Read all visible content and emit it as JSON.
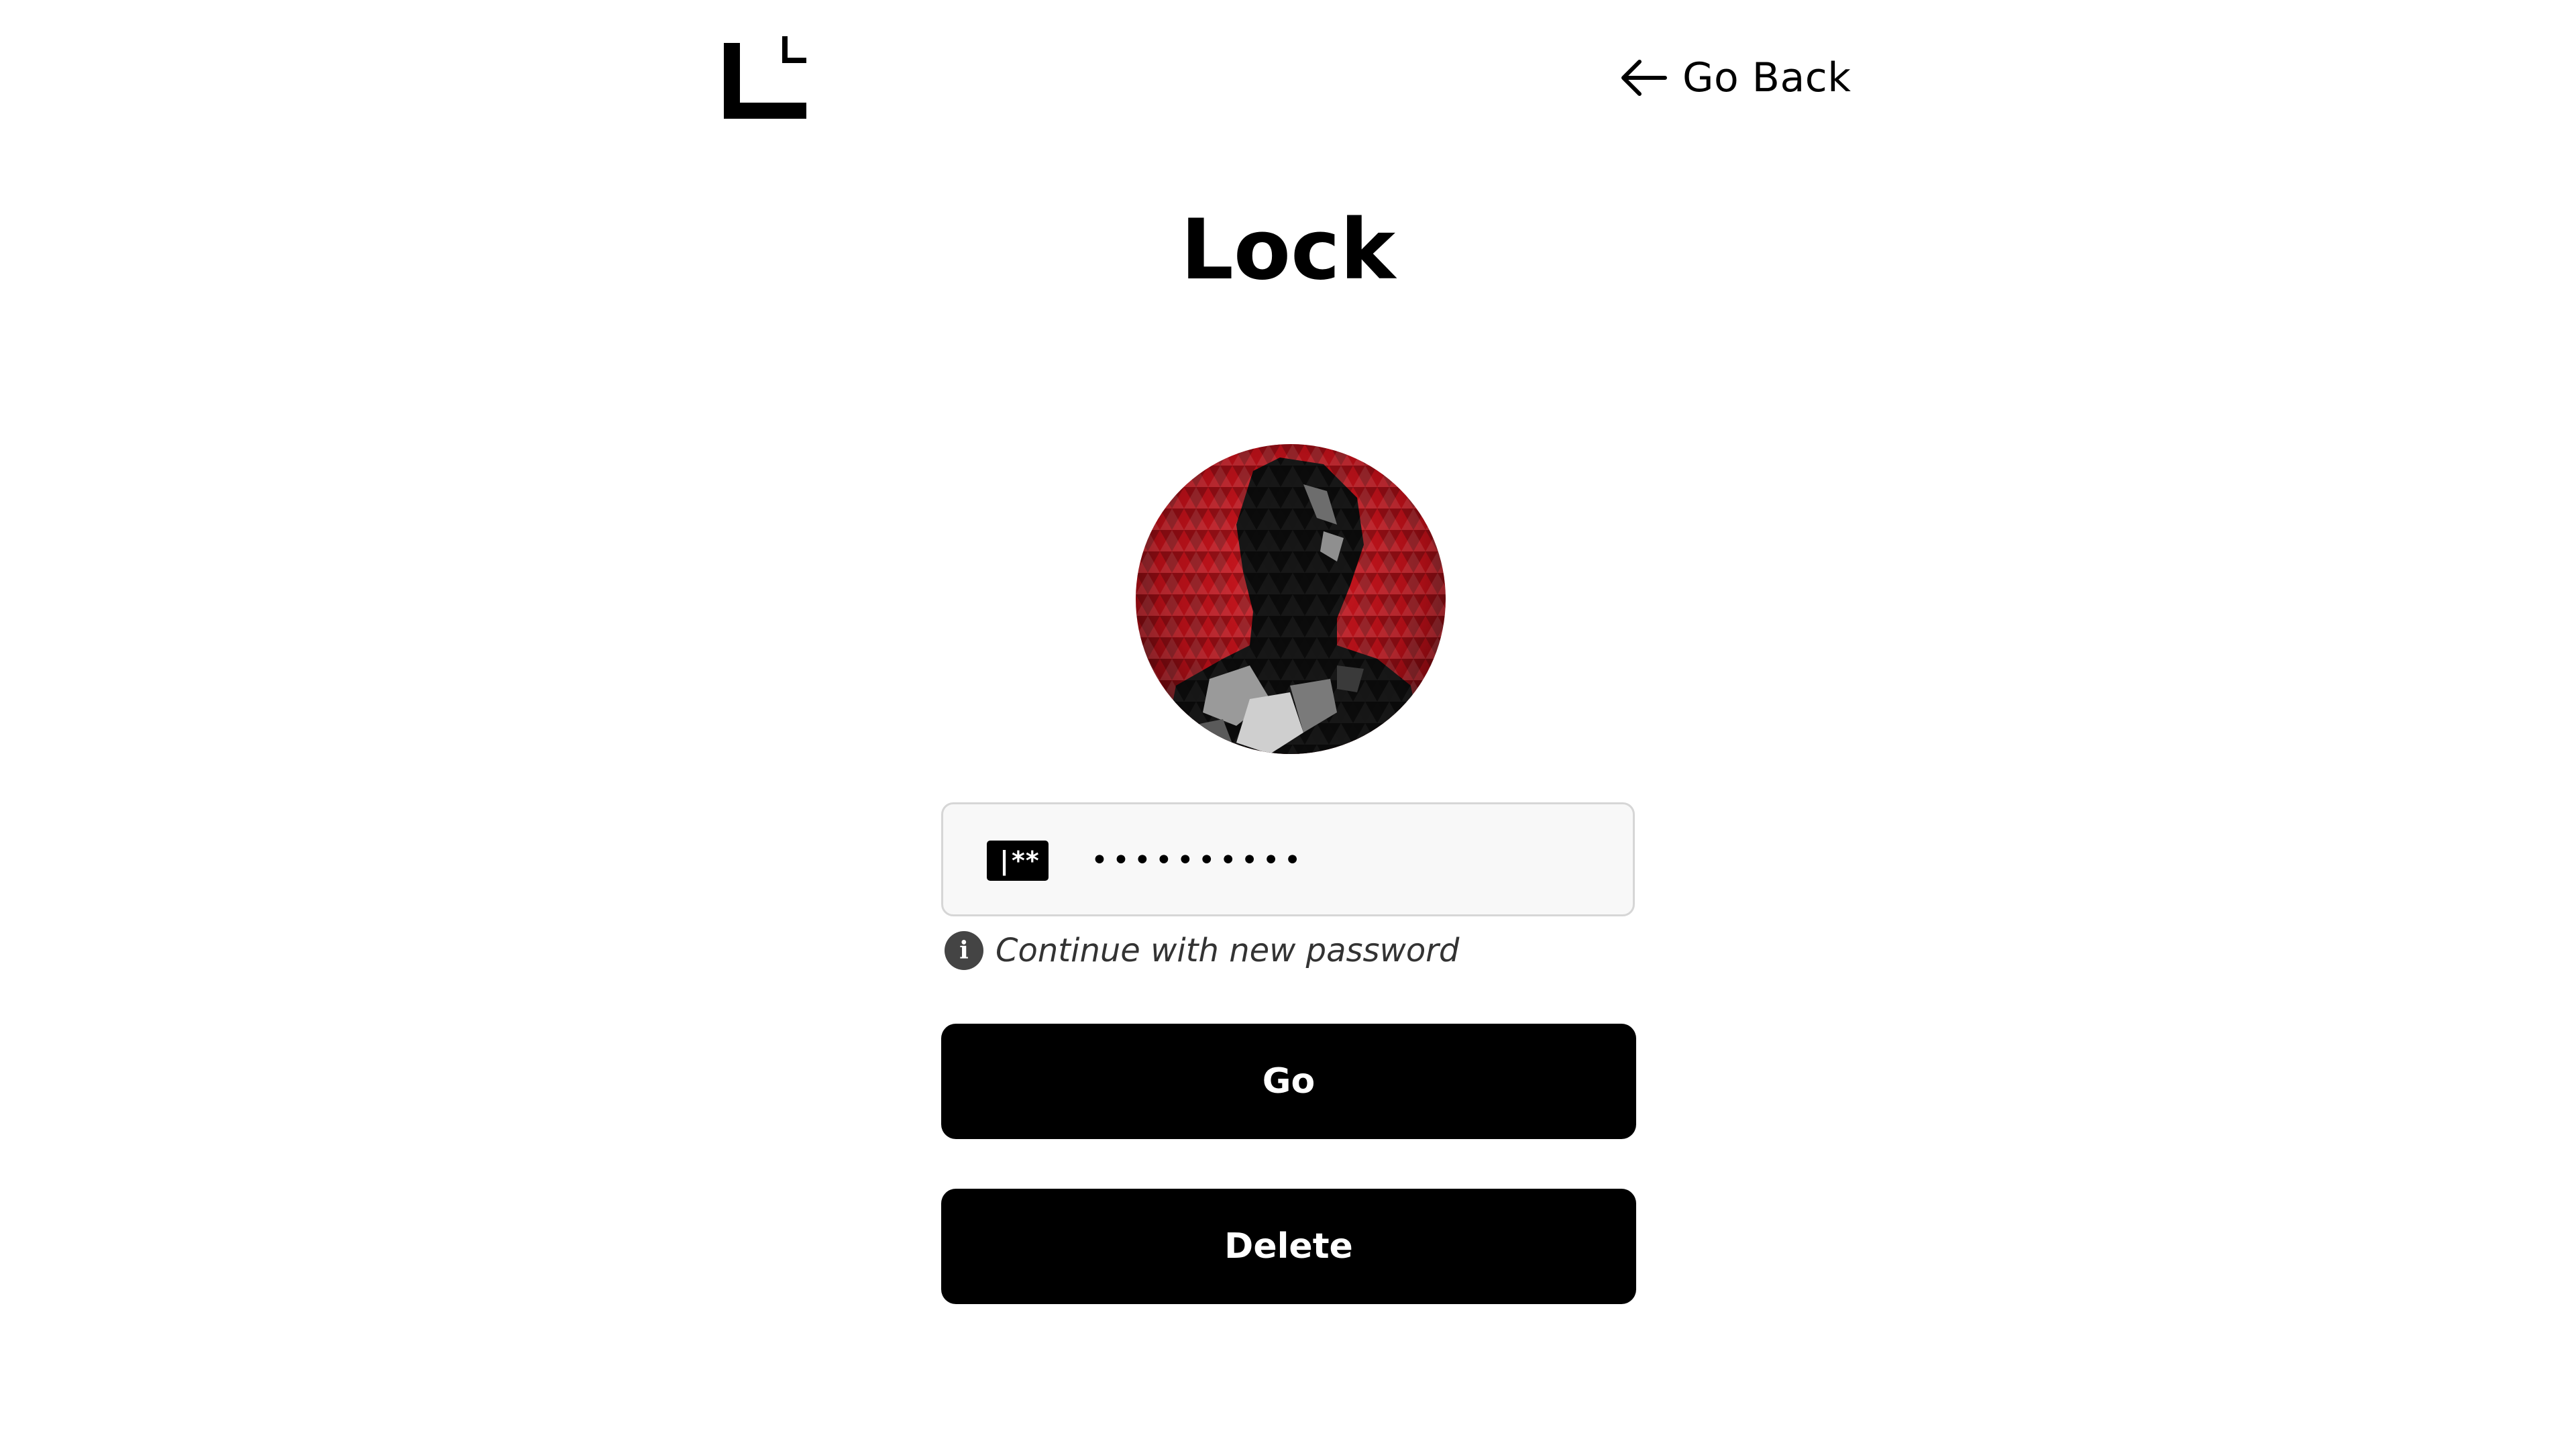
{
  "header": {
    "logo_icon": "corner-bracket-logo",
    "back_icon": "arrow-left-icon",
    "back_label": "Go Back"
  },
  "title": "Lock",
  "avatar": {
    "icon": "pixelated-profile-photo",
    "colors": {
      "accent": "#c0101a",
      "dark": "#0a0a0a"
    }
  },
  "password": {
    "icon": "password-field-icon",
    "icon_text": "|**",
    "value": "••••••••••",
    "hint_icon": "info-icon",
    "hint_icon_glyph": "i",
    "hint": "Continue with new password"
  },
  "buttons": {
    "go": "Go",
    "delete": "Delete"
  },
  "colors": {
    "background": "#ffffff",
    "button": "#000000",
    "button_text": "#ffffff",
    "field_border": "#d6d6d6",
    "field_bg": "#f8f8f8"
  }
}
